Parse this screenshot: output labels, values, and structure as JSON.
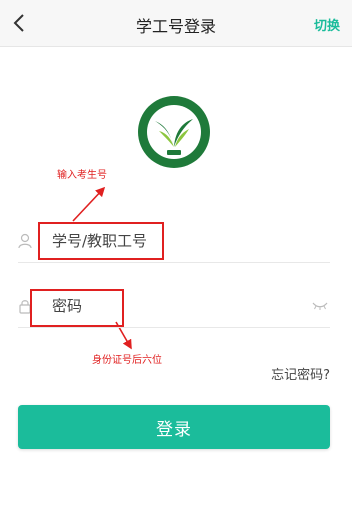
{
  "header": {
    "title": "学工号登录",
    "switch_label": "切换"
  },
  "annotations": {
    "username_hint": "输入考生号",
    "password_hint": "身份证号后六位"
  },
  "form": {
    "username_placeholder": "学号/教职工号",
    "password_placeholder": "密码",
    "forgot_label": "忘记密码?",
    "login_label": "登录"
  },
  "colors": {
    "accent": "#1bbc9b",
    "annotation": "#e02020"
  },
  "icons": [
    "back-icon",
    "user-icon",
    "lock-icon",
    "eye-closed-icon",
    "school-logo"
  ]
}
